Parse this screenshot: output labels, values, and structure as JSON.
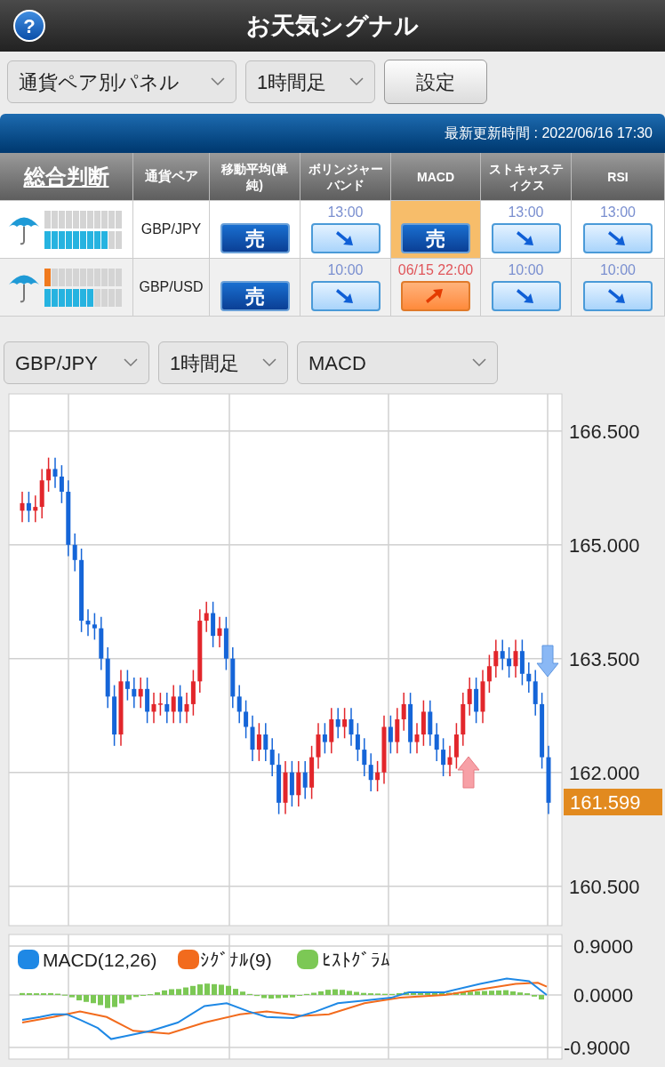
{
  "header": {
    "title": "お天気シグナル",
    "help": "?"
  },
  "toolbar": {
    "view_select": "通貨ペア別パネル",
    "timeframe_select": "1時間足",
    "settings_button": "設定"
  },
  "update_bar": {
    "text": "最新更新時間 : 2022/06/16 17:30"
  },
  "signal_table": {
    "columns": [
      "総合判断",
      "通貨ペア",
      "移動平均(単純)",
      "ボリンジャーバンド",
      "MACD",
      "ストキャスティクス",
      "RSI"
    ],
    "rows": [
      {
        "weather_icon": {
          "kind": "rain"
        },
        "meter": {
          "buy": {
            "level": 0
          },
          "sell": {
            "level": 0.818
          }
        },
        "pair": "GBP/JPY",
        "signals": [
          {
            "kind": "sell",
            "label": "売",
            "highlighted": false
          },
          {
            "kind": "down",
            "time": "13:00",
            "highlighted": false
          },
          {
            "kind": "sell",
            "label": "売",
            "highlighted": true
          },
          {
            "kind": "down",
            "time": "13:00",
            "highlighted": false
          },
          {
            "kind": "down",
            "time": "13:00",
            "highlighted": false
          }
        ]
      },
      {
        "weather_icon": {
          "kind": "rain"
        },
        "meter": {
          "buy": {
            "level": 0.091
          },
          "sell": {
            "level": 0.636
          }
        },
        "pair": "GBP/USD",
        "signals": [
          {
            "kind": "sell",
            "label": "売",
            "highlighted": false
          },
          {
            "kind": "down",
            "time": "10:00",
            "highlighted": false
          },
          {
            "kind": "up",
            "time": "06/15 22:00",
            "highlighted": false
          },
          {
            "kind": "down",
            "time": "10:00",
            "highlighted": false
          },
          {
            "kind": "down",
            "time": "10:00",
            "highlighted": false
          }
        ]
      }
    ]
  },
  "chart_controls": {
    "pair_select": "GBP/JPY",
    "timeframe_select": "1時間足",
    "indicator_select": "MACD"
  },
  "price_chart": {
    "current_price": "161.599",
    "chart_data": {
      "type": "candlestick",
      "grid": true,
      "ylim": [
        159.98,
        166.99
      ],
      "yticks": [
        {
          "value": 166.5,
          "label": "166.500"
        },
        {
          "value": 165,
          "label": "165.000"
        },
        {
          "value": 163.5,
          "label": "163.500"
        },
        {
          "value": 162,
          "label": "162.000"
        },
        {
          "value": 160.5,
          "label": "160.500"
        }
      ],
      "ohlc": [
        [
          165.45,
          165.7,
          165.3,
          165.55
        ],
        [
          165.55,
          165.7,
          165.3,
          165.45
        ],
        [
          165.45,
          165.65,
          165.3,
          165.5
        ],
        [
          165.5,
          166.0,
          165.35,
          165.85
        ],
        [
          165.85,
          166.15,
          165.7,
          166.0
        ],
        [
          166.0,
          166.15,
          165.75,
          165.9
        ],
        [
          165.9,
          166.05,
          165.55,
          165.7
        ],
        [
          165.7,
          165.85,
          164.85,
          165.0
        ],
        [
          165.0,
          165.15,
          164.65,
          164.8
        ],
        [
          164.8,
          164.95,
          163.85,
          164.0
        ],
        [
          164.0,
          164.15,
          163.8,
          163.95
        ],
        [
          163.95,
          164.1,
          163.75,
          163.9
        ],
        [
          163.9,
          164.05,
          163.35,
          163.5
        ],
        [
          163.5,
          163.65,
          162.85,
          163.0
        ],
        [
          163.0,
          163.15,
          162.35,
          162.5
        ],
        [
          162.5,
          163.35,
          162.35,
          163.2
        ],
        [
          163.2,
          163.35,
          162.95,
          163.1
        ],
        [
          163.1,
          163.25,
          162.85,
          163.0
        ],
        [
          163.0,
          163.25,
          162.85,
          163.1
        ],
        [
          163.1,
          163.25,
          162.65,
          162.8
        ],
        [
          162.8,
          163.05,
          162.65,
          162.9
        ],
        [
          162.9,
          163.05,
          162.75,
          162.9
        ],
        [
          162.9,
          163.05,
          162.65,
          162.8
        ],
        [
          162.8,
          163.15,
          162.65,
          163.0
        ],
        [
          163.0,
          163.15,
          162.65,
          162.8
        ],
        [
          162.8,
          163.05,
          162.65,
          162.9
        ],
        [
          162.9,
          163.35,
          162.75,
          163.2
        ],
        [
          163.2,
          164.15,
          163.05,
          164.0
        ],
        [
          164.0,
          164.25,
          163.85,
          164.1
        ],
        [
          164.1,
          164.25,
          163.65,
          163.8
        ],
        [
          163.8,
          164.05,
          163.65,
          163.9
        ],
        [
          163.9,
          164.05,
          163.35,
          163.5
        ],
        [
          163.5,
          163.65,
          162.85,
          163.0
        ],
        [
          163.0,
          163.15,
          162.65,
          162.8
        ],
        [
          162.8,
          162.95,
          162.45,
          162.6
        ],
        [
          162.6,
          162.75,
          162.15,
          162.3
        ],
        [
          162.3,
          162.65,
          162.15,
          162.5
        ],
        [
          162.5,
          162.65,
          162.15,
          162.3
        ],
        [
          162.3,
          162.45,
          161.95,
          162.1
        ],
        [
          162.1,
          162.25,
          161.45,
          161.6
        ],
        [
          161.6,
          162.15,
          161.45,
          162.0
        ],
        [
          162.0,
          162.15,
          161.55,
          161.7
        ],
        [
          161.7,
          162.15,
          161.55,
          162.0
        ],
        [
          162.0,
          162.15,
          161.65,
          161.8
        ],
        [
          161.8,
          162.35,
          161.65,
          162.2
        ],
        [
          162.2,
          162.65,
          162.05,
          162.5
        ],
        [
          162.5,
          162.65,
          162.25,
          162.4
        ],
        [
          162.4,
          162.85,
          162.25,
          162.7
        ],
        [
          162.7,
          162.85,
          162.45,
          162.6
        ],
        [
          162.6,
          162.85,
          162.45,
          162.7
        ],
        [
          162.7,
          162.85,
          162.35,
          162.5
        ],
        [
          162.5,
          162.65,
          162.15,
          162.3
        ],
        [
          162.3,
          162.45,
          161.95,
          162.1
        ],
        [
          162.1,
          162.25,
          161.75,
          161.9
        ],
        [
          161.9,
          162.15,
          161.75,
          162.0
        ],
        [
          162.0,
          162.75,
          161.85,
          162.6
        ],
        [
          162.6,
          162.75,
          162.25,
          162.4
        ],
        [
          162.4,
          162.85,
          162.25,
          162.7
        ],
        [
          162.7,
          163.05,
          162.55,
          162.9
        ],
        [
          162.9,
          163.05,
          162.25,
          162.4
        ],
        [
          162.4,
          162.65,
          162.25,
          162.5
        ],
        [
          162.5,
          162.95,
          162.35,
          162.8
        ],
        [
          162.8,
          162.95,
          162.35,
          162.5
        ],
        [
          162.5,
          162.65,
          162.15,
          162.3
        ],
        [
          162.3,
          162.45,
          161.95,
          162.1
        ],
        [
          162.1,
          162.35,
          161.95,
          162.2
        ],
        [
          162.2,
          162.65,
          162.05,
          162.5
        ],
        [
          162.5,
          163.05,
          162.35,
          162.9
        ],
        [
          162.9,
          163.25,
          162.75,
          163.1
        ],
        [
          163.1,
          163.25,
          162.65,
          162.8
        ],
        [
          162.8,
          163.35,
          162.65,
          163.2
        ],
        [
          163.2,
          163.55,
          163.05,
          163.4
        ],
        [
          163.4,
          163.75,
          163.25,
          163.6
        ],
        [
          163.6,
          163.75,
          163.35,
          163.5
        ],
        [
          163.5,
          163.65,
          163.25,
          163.4
        ],
        [
          163.4,
          163.75,
          163.25,
          163.6
        ],
        [
          163.6,
          163.75,
          163.15,
          163.3
        ],
        [
          163.3,
          163.45,
          163.05,
          163.2
        ],
        [
          163.2,
          163.35,
          162.75,
          162.9
        ],
        [
          162.9,
          163.05,
          162.05,
          162.2
        ],
        [
          162.2,
          162.35,
          161.45,
          161.6
        ]
      ]
    }
  },
  "macd_chart": {
    "legend": [
      {
        "label": "MACD(12,26)",
        "color": "#1e88e5"
      },
      {
        "label": "ｼｸﾞﾅﾙ(9)",
        "color": "#f26b1d"
      },
      {
        "label": "ﾋｽﾄｸﾞﾗﾑ",
        "color": "#7cc855"
      }
    ],
    "axis_labels": [
      "0.9000",
      "0.0000",
      "-0.9000"
    ]
  }
}
